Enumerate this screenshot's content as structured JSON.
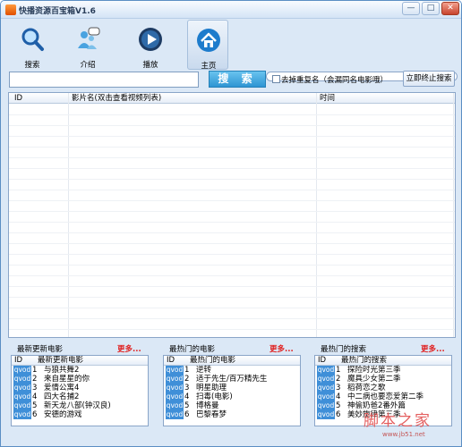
{
  "window": {
    "title": "快播资源百宝箱V1.6",
    "min_label": "—",
    "max_label": "□",
    "close_label": "✕"
  },
  "toolbar": {
    "items": [
      {
        "label": "搜索",
        "icon": "magnifier-icon"
      },
      {
        "label": "介绍",
        "icon": "people-chat-icon"
      },
      {
        "label": "播放",
        "icon": "play-icon"
      },
      {
        "label": "主页",
        "icon": "home-icon"
      }
    ]
  },
  "search": {
    "value": "",
    "button_label": "搜 索",
    "dedupe_label": "去掉重复名（会漏同名电影哦）",
    "dedupe_checked": false,
    "stop_label": "立即终止搜索"
  },
  "results": {
    "columns": [
      "ID",
      "影片名(双击查看视频列表)",
      "时间"
    ],
    "rows": []
  },
  "panels": [
    {
      "title": "最新更新电影",
      "more": "更多...",
      "columns": [
        "ID",
        "最新更新电影"
      ],
      "rows": [
        {
          "tag": "qvod",
          "id": "1",
          "name": "与狼共舞2"
        },
        {
          "tag": "qvod",
          "id": "2",
          "name": "来自星星的你"
        },
        {
          "tag": "qvod",
          "id": "3",
          "name": "爱情公寓4"
        },
        {
          "tag": "qvod",
          "id": "4",
          "name": "四大名捕2"
        },
        {
          "tag": "qvod",
          "id": "5",
          "name": "新天龙八部(钟汉良)"
        },
        {
          "tag": "qvod",
          "id": "6",
          "name": "安德的游戏"
        }
      ]
    },
    {
      "title": "最热门的电影",
      "more": "更多...",
      "columns": [
        "ID",
        "最热门的电影"
      ],
      "rows": [
        {
          "tag": "qvod",
          "id": "1",
          "name": "逆转"
        },
        {
          "tag": "qvod",
          "id": "2",
          "name": "适于先生/百万精先生"
        },
        {
          "tag": "qvod",
          "id": "3",
          "name": "明星助理"
        },
        {
          "tag": "qvod",
          "id": "4",
          "name": "扫毒(电影)"
        },
        {
          "tag": "qvod",
          "id": "5",
          "name": "博格曼"
        },
        {
          "tag": "qvod",
          "id": "6",
          "name": "巴黎春梦"
        }
      ]
    },
    {
      "title": "最热门的搜索",
      "more": "更多...",
      "columns": [
        "ID",
        "最热门的搜索"
      ],
      "rows": [
        {
          "tag": "qvod",
          "id": "1",
          "name": "探险时光第三季"
        },
        {
          "tag": "qvod",
          "id": "2",
          "name": "魔具少女第二季"
        },
        {
          "tag": "qvod",
          "id": "3",
          "name": "稻荷恋之歌"
        },
        {
          "tag": "qvod",
          "id": "4",
          "name": "中二病也要恋爱第二季"
        },
        {
          "tag": "qvod",
          "id": "5",
          "name": "神偷奶爸2番外篇"
        },
        {
          "tag": "qvod",
          "id": "6",
          "name": "美妙旋律第三季"
        }
      ]
    }
  ],
  "watermark": {
    "text": "脚本之家",
    "url": "www.jb51.net"
  },
  "colors": {
    "accent": "#2e95d3",
    "more_link": "#e02020",
    "qvod_tag": "#3f8fd8"
  }
}
